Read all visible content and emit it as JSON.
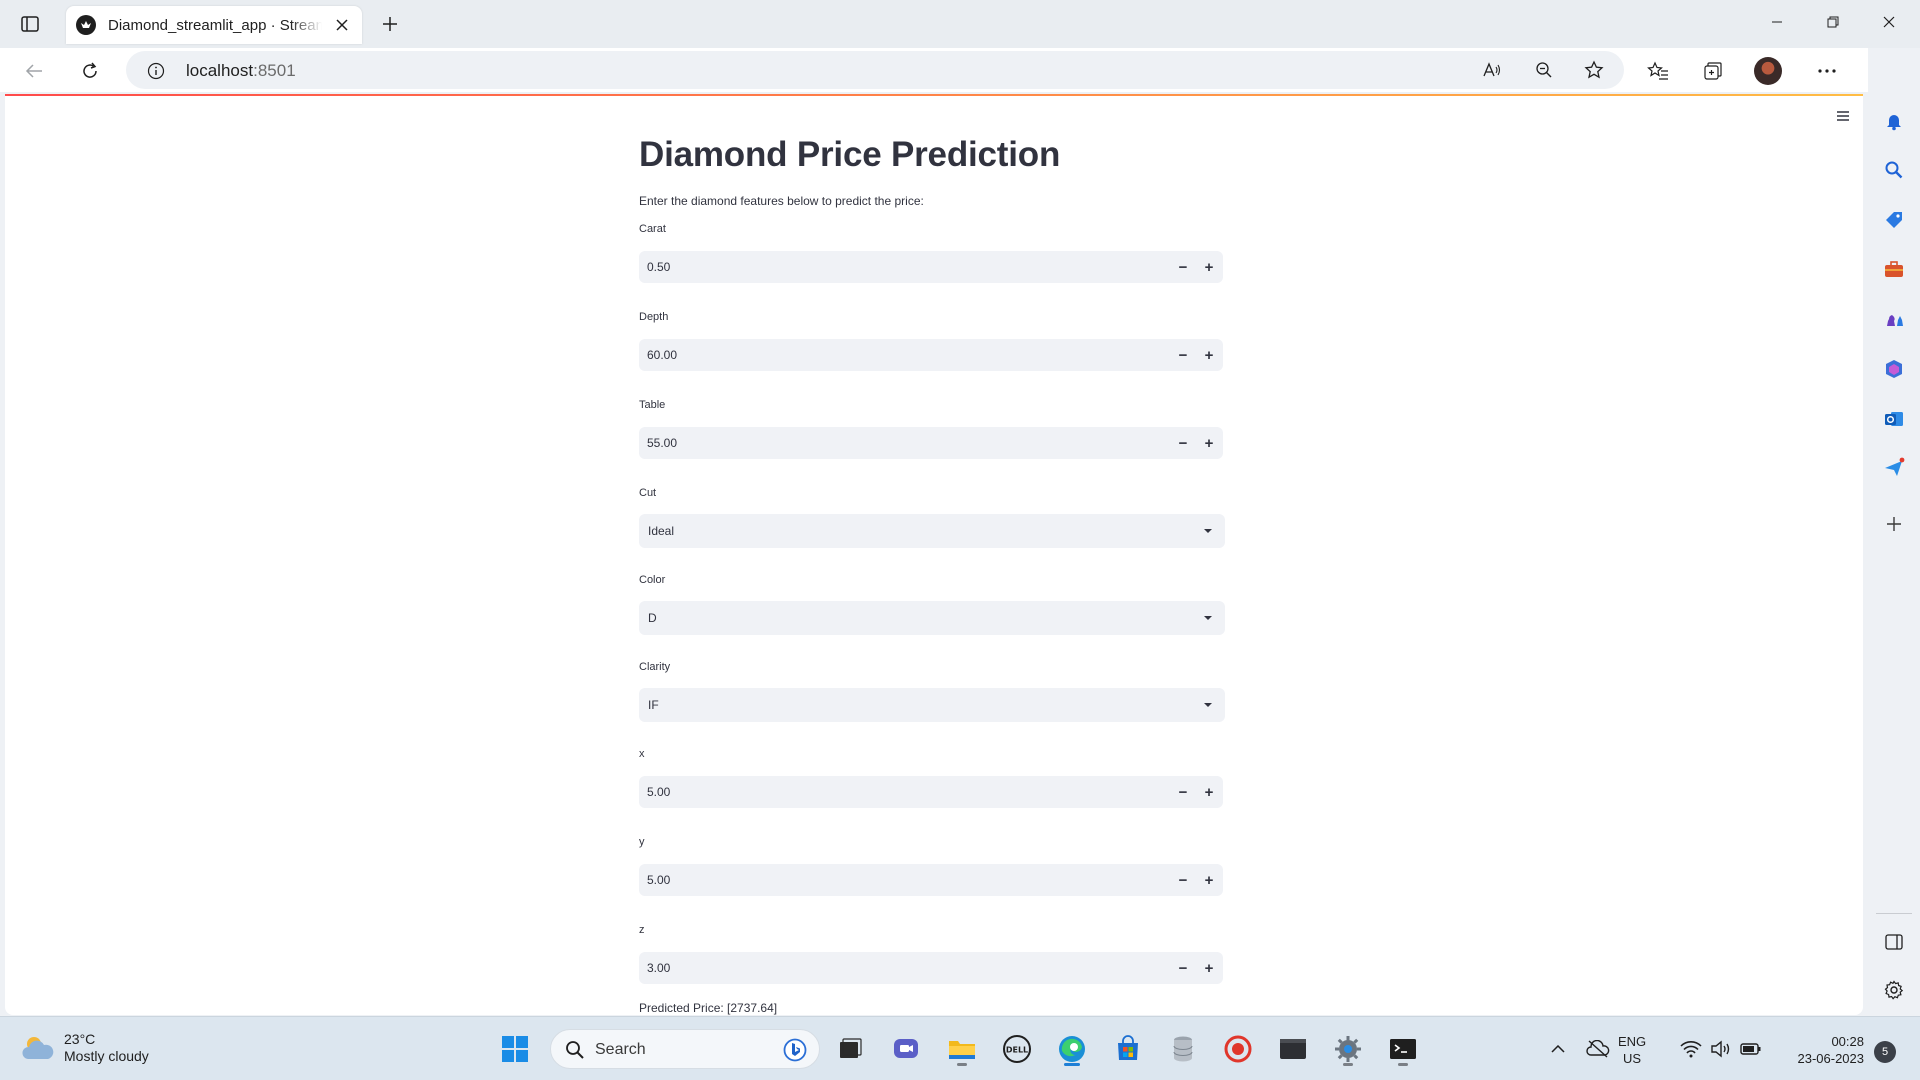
{
  "browser": {
    "tab_title": "Diamond_streamlit_app · Streamlit",
    "url_host": "localhost",
    "url_port": ":8501"
  },
  "app": {
    "title": "Diamond Price Prediction",
    "subtitle": "Enter the diamond features below to predict the price:",
    "fields": {
      "carat": {
        "label": "Carat",
        "value": "0.50"
      },
      "depth": {
        "label": "Depth",
        "value": "60.00"
      },
      "table": {
        "label": "Table",
        "value": "55.00"
      },
      "cut": {
        "label": "Cut",
        "value": "Ideal"
      },
      "color": {
        "label": "Color",
        "value": "D"
      },
      "clarity": {
        "label": "Clarity",
        "value": "IF"
      },
      "x": {
        "label": "x",
        "value": "5.00"
      },
      "y": {
        "label": "y",
        "value": "5.00"
      },
      "z": {
        "label": "z",
        "value": "3.00"
      }
    },
    "stepper_minus": "−",
    "stepper_plus": "+",
    "result": "Predicted Price: [2737.64]"
  },
  "taskbar": {
    "weather_temp": "23°C",
    "weather_desc": "Mostly cloudy",
    "search_placeholder": "Search",
    "lang_line1": "ENG",
    "lang_line2": "US",
    "time": "00:28",
    "date": "23-06-2023",
    "notification_count": "5"
  },
  "colors": {
    "accent_red": "#ff4b4b",
    "input_bg": "#f0f2f6",
    "text": "#31333f",
    "edge_blue": "#1e7fd6"
  }
}
